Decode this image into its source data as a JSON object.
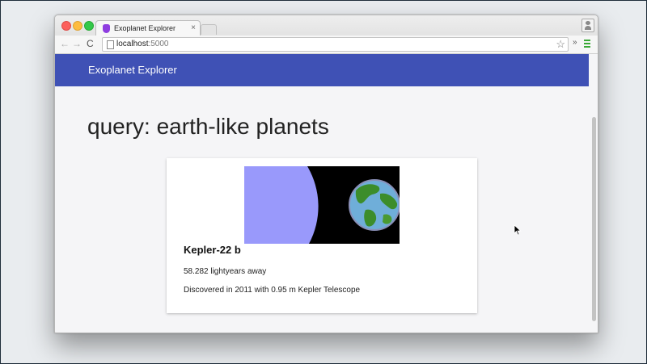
{
  "browser": {
    "tab_title": "Exoplanet Explorer",
    "tab_close": "×",
    "url_host": "localhost",
    "url_port": ":5000",
    "back_icon": "←",
    "forward_icon": "→",
    "reload_icon": "C",
    "star_icon": "☆",
    "extend_icon": "»"
  },
  "app": {
    "title": "Exoplanet Explorer",
    "brand_color": "#3f51b5"
  },
  "page": {
    "heading": "query: earth-like planets"
  },
  "results": [
    {
      "name": "Kepler-22 b",
      "distance": "58.282 lightyears away",
      "discovery": "Discovered in 2011 with 0.95 m Kepler Telescope",
      "image_icon": "planet-earth-comparison"
    }
  ]
}
